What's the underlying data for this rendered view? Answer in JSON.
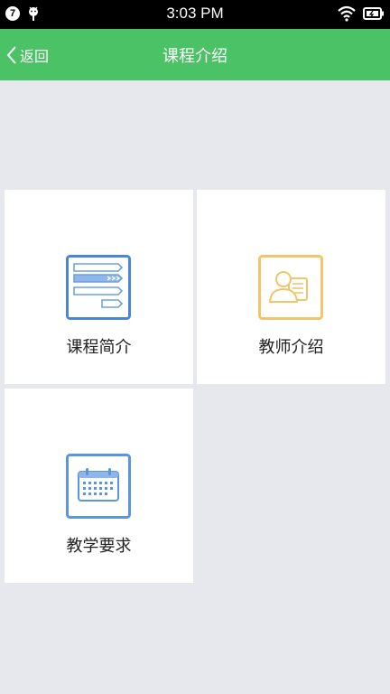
{
  "status_bar": {
    "notification_count": "7",
    "time": "3:03 PM",
    "icons": [
      "notification-badge-icon",
      "android-icon",
      "wifi-icon",
      "battery-charging-icon"
    ]
  },
  "header": {
    "back_label": "返回",
    "title": "课程介绍",
    "background_color": "#4bc265"
  },
  "tiles": [
    {
      "label": "课程简介",
      "icon": "course-intro-icon",
      "icon_color": "#4a86d8"
    },
    {
      "label": "教师介绍",
      "icon": "teacher-icon",
      "icon_color": "#f2c56a"
    },
    {
      "label": "教学要求",
      "icon": "calendar-icon",
      "icon_color": "#5b95e0"
    }
  ]
}
